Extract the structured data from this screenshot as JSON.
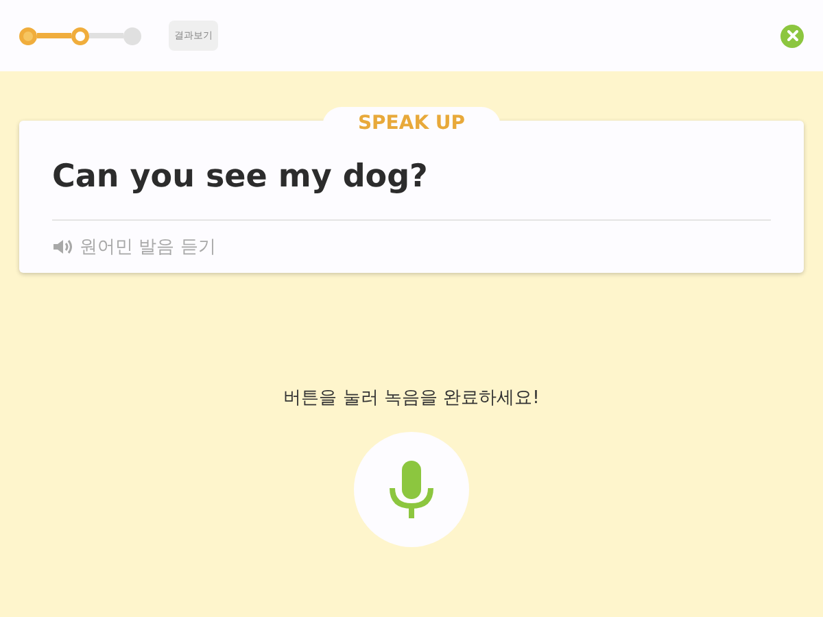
{
  "progress": {
    "steps": [
      {
        "kind": "done"
      },
      {
        "kind": "current"
      },
      {
        "kind": "pending"
      }
    ]
  },
  "results_button": {
    "label": "결과보기"
  },
  "card": {
    "tab": "SPEAK UP",
    "sentence": "Can you see my dog?",
    "listen": {
      "label": "원어민 발음 듣기",
      "disabled": true
    }
  },
  "prompt": "버튼을 눌러 녹음을 완료하세요!"
}
